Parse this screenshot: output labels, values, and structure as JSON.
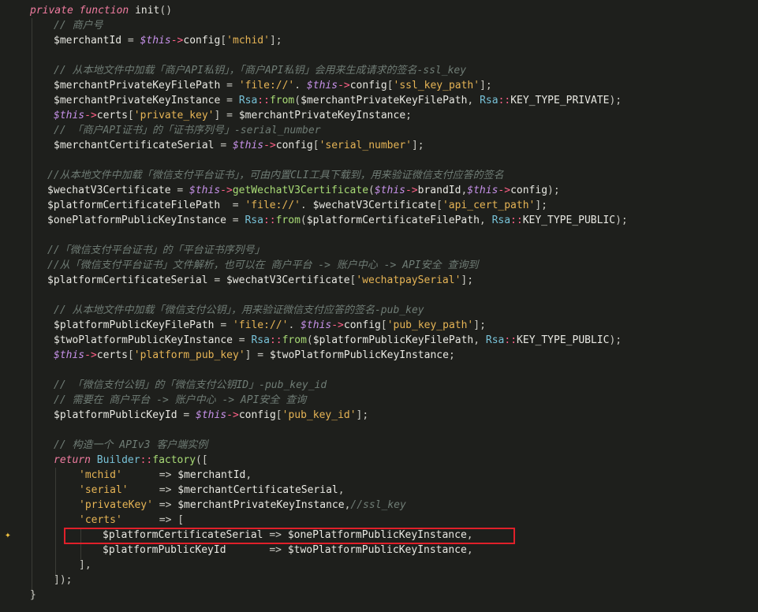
{
  "editor": {
    "lines": [
      {
        "indent": 38,
        "tokens": [
          [
            "kw",
            "private "
          ],
          [
            "kw",
            "function "
          ],
          [
            "fn",
            "init"
          ],
          [
            "pun",
            "()"
          ]
        ]
      },
      {
        "indent": 68,
        "tokens": [
          [
            "cmt",
            "// 商户号"
          ]
        ]
      },
      {
        "indent": 68,
        "tokens": [
          [
            "var",
            "$merchantId"
          ],
          [
            "pun",
            " = "
          ],
          [
            "this",
            "$this"
          ],
          [
            "op",
            "->"
          ],
          [
            "var",
            "config"
          ],
          [
            "pun",
            "["
          ],
          [
            "str",
            "'mchid'"
          ],
          [
            "pun",
            "];"
          ]
        ]
      },
      {
        "indent": 68,
        "tokens": []
      },
      {
        "indent": 68,
        "tokens": [
          [
            "cmt",
            "// 从本地文件中加载「商户API私钥」，「商户API私钥」会用来生成请求的签名-ssl_key"
          ]
        ]
      },
      {
        "indent": 68,
        "tokens": [
          [
            "var",
            "$merchantPrivateKeyFilePath"
          ],
          [
            "pun",
            " = "
          ],
          [
            "str",
            "'file://'"
          ],
          [
            "pun",
            ". "
          ],
          [
            "this",
            "$this"
          ],
          [
            "op",
            "->"
          ],
          [
            "var",
            "config"
          ],
          [
            "pun",
            "["
          ],
          [
            "str",
            "'ssl_key_path'"
          ],
          [
            "pun",
            "];"
          ]
        ]
      },
      {
        "indent": 68,
        "tokens": [
          [
            "var",
            "$merchantPrivateKeyInstance"
          ],
          [
            "pun",
            " = "
          ],
          [
            "cls",
            "Rsa"
          ],
          [
            "op",
            "::"
          ],
          [
            "meth",
            "from"
          ],
          [
            "pun",
            "("
          ],
          [
            "var",
            "$merchantPrivateKeyFilePath"
          ],
          [
            "pun",
            ", "
          ],
          [
            "cls",
            "Rsa"
          ],
          [
            "op",
            "::"
          ],
          [
            "var",
            "KEY_TYPE_PRIVATE"
          ],
          [
            "pun",
            ");"
          ]
        ]
      },
      {
        "indent": 68,
        "tokens": [
          [
            "this",
            "$this"
          ],
          [
            "op",
            "->"
          ],
          [
            "var",
            "certs"
          ],
          [
            "pun",
            "["
          ],
          [
            "str",
            "'private_key'"
          ],
          [
            "pun",
            "] = "
          ],
          [
            "var",
            "$merchantPrivateKeyInstance"
          ],
          [
            "pun",
            ";"
          ]
        ]
      },
      {
        "indent": 68,
        "tokens": [
          [
            "cmt",
            "// 「商户API证书」的「证书序列号」-serial_number"
          ]
        ]
      },
      {
        "indent": 68,
        "tokens": [
          [
            "var",
            "$merchantCertificateSerial"
          ],
          [
            "pun",
            " = "
          ],
          [
            "this",
            "$this"
          ],
          [
            "op",
            "->"
          ],
          [
            "var",
            "config"
          ],
          [
            "pun",
            "["
          ],
          [
            "str",
            "'serial_number'"
          ],
          [
            "pun",
            "];"
          ]
        ]
      },
      {
        "indent": 68,
        "tokens": []
      },
      {
        "indent": 60,
        "tokens": [
          [
            "cmt",
            "//从本地文件中加载「微信支付平台证书」，可由内置CLI工具下载到，用来验证微信支付应答的签名"
          ]
        ]
      },
      {
        "indent": 60,
        "tokens": [
          [
            "var",
            "$wechatV3Certificate"
          ],
          [
            "pun",
            " = "
          ],
          [
            "this",
            "$this"
          ],
          [
            "op",
            "->"
          ],
          [
            "meth",
            "getWechatV3Certificate"
          ],
          [
            "pun",
            "("
          ],
          [
            "this",
            "$this"
          ],
          [
            "op",
            "->"
          ],
          [
            "var",
            "brandId"
          ],
          [
            "pun",
            ","
          ],
          [
            "this",
            "$this"
          ],
          [
            "op",
            "->"
          ],
          [
            "var",
            "config"
          ],
          [
            "pun",
            ");"
          ]
        ]
      },
      {
        "indent": 60,
        "tokens": [
          [
            "var",
            "$platformCertificateFilePath"
          ],
          [
            "pun",
            "  = "
          ],
          [
            "str",
            "'file://'"
          ],
          [
            "pun",
            ". "
          ],
          [
            "var",
            "$wechatV3Certificate"
          ],
          [
            "pun",
            "["
          ],
          [
            "str",
            "'api_cert_path'"
          ],
          [
            "pun",
            "];"
          ]
        ]
      },
      {
        "indent": 60,
        "tokens": [
          [
            "var",
            "$onePlatformPublicKeyInstance"
          ],
          [
            "pun",
            " = "
          ],
          [
            "cls",
            "Rsa"
          ],
          [
            "op",
            "::"
          ],
          [
            "meth",
            "from"
          ],
          [
            "pun",
            "("
          ],
          [
            "var",
            "$platformCertificateFilePath"
          ],
          [
            "pun",
            ", "
          ],
          [
            "cls",
            "Rsa"
          ],
          [
            "op",
            "::"
          ],
          [
            "var",
            "KEY_TYPE_PUBLIC"
          ],
          [
            "pun",
            ");"
          ]
        ]
      },
      {
        "indent": 60,
        "tokens": []
      },
      {
        "indent": 60,
        "tokens": [
          [
            "cmt",
            "//「微信支付平台证书」的「平台证书序列号」"
          ]
        ]
      },
      {
        "indent": 60,
        "tokens": [
          [
            "cmt",
            "//从「微信支付平台证书」文件解析，也可以在 商户平台 -> 账户中心 -> API安全 查询到"
          ]
        ]
      },
      {
        "indent": 60,
        "tokens": [
          [
            "var",
            "$platformCertificateSerial"
          ],
          [
            "pun",
            " = "
          ],
          [
            "var",
            "$wechatV3Certificate"
          ],
          [
            "pun",
            "["
          ],
          [
            "str",
            "'wechatpaySerial'"
          ],
          [
            "pun",
            "];"
          ]
        ]
      },
      {
        "indent": 68,
        "tokens": []
      },
      {
        "indent": 68,
        "tokens": [
          [
            "cmt",
            "// 从本地文件中加载「微信支付公钥」，用来验证微信支付应答的签名-pub_key"
          ]
        ]
      },
      {
        "indent": 68,
        "tokens": [
          [
            "var",
            "$platformPublicKeyFilePath"
          ],
          [
            "pun",
            " = "
          ],
          [
            "str",
            "'file://'"
          ],
          [
            "pun",
            ". "
          ],
          [
            "this",
            "$this"
          ],
          [
            "op",
            "->"
          ],
          [
            "var",
            "config"
          ],
          [
            "pun",
            "["
          ],
          [
            "str",
            "'pub_key_path'"
          ],
          [
            "pun",
            "];"
          ]
        ]
      },
      {
        "indent": 68,
        "tokens": [
          [
            "var",
            "$twoPlatformPublicKeyInstance"
          ],
          [
            "pun",
            " = "
          ],
          [
            "cls",
            "Rsa"
          ],
          [
            "op",
            "::"
          ],
          [
            "meth",
            "from"
          ],
          [
            "pun",
            "("
          ],
          [
            "var",
            "$platformPublicKeyFilePath"
          ],
          [
            "pun",
            ", "
          ],
          [
            "cls",
            "Rsa"
          ],
          [
            "op",
            "::"
          ],
          [
            "var",
            "KEY_TYPE_PUBLIC"
          ],
          [
            "pun",
            ");"
          ]
        ]
      },
      {
        "indent": 68,
        "tokens": [
          [
            "this",
            "$this"
          ],
          [
            "op",
            "->"
          ],
          [
            "var",
            "certs"
          ],
          [
            "pun",
            "["
          ],
          [
            "str",
            "'platform_pub_key'"
          ],
          [
            "pun",
            "] = "
          ],
          [
            "var",
            "$twoPlatformPublicKeyInstance"
          ],
          [
            "pun",
            ";"
          ]
        ]
      },
      {
        "indent": 68,
        "tokens": []
      },
      {
        "indent": 68,
        "tokens": [
          [
            "cmt",
            "// 「微信支付公钥」的「微信支付公钥ID」-pub_key_id"
          ]
        ]
      },
      {
        "indent": 68,
        "tokens": [
          [
            "cmt",
            "// 需要在 商户平台 -> 账户中心 -> API安全 查询"
          ]
        ]
      },
      {
        "indent": 68,
        "tokens": [
          [
            "var",
            "$platformPublicKeyId"
          ],
          [
            "pun",
            " = "
          ],
          [
            "this",
            "$this"
          ],
          [
            "op",
            "->"
          ],
          [
            "var",
            "config"
          ],
          [
            "pun",
            "["
          ],
          [
            "str",
            "'pub_key_id'"
          ],
          [
            "pun",
            "];"
          ]
        ]
      },
      {
        "indent": 68,
        "tokens": []
      },
      {
        "indent": 68,
        "tokens": [
          [
            "cmt",
            "// 构造一个 APIv3 客户端实例"
          ]
        ]
      },
      {
        "indent": 68,
        "tokens": [
          [
            "kw",
            "return "
          ],
          [
            "cls",
            "Builder"
          ],
          [
            "op",
            "::"
          ],
          [
            "meth",
            "factory"
          ],
          [
            "pun",
            "(["
          ]
        ]
      },
      {
        "indent": 100,
        "tokens": [
          [
            "str",
            "'mchid'"
          ],
          [
            "pun",
            "      => "
          ],
          [
            "var",
            "$merchantId"
          ],
          [
            "pun",
            ","
          ]
        ]
      },
      {
        "indent": 100,
        "tokens": [
          [
            "str",
            "'serial'"
          ],
          [
            "pun",
            "     => "
          ],
          [
            "var",
            "$merchantCertificateSerial"
          ],
          [
            "pun",
            ","
          ]
        ]
      },
      {
        "indent": 100,
        "tokens": [
          [
            "str",
            "'privateKey'"
          ],
          [
            "pun",
            " => "
          ],
          [
            "var",
            "$merchantPrivateKeyInstance"
          ],
          [
            "pun",
            ","
          ],
          [
            "cmt",
            "//ssl_key"
          ]
        ]
      },
      {
        "indent": 100,
        "tokens": [
          [
            "str",
            "'certs'"
          ],
          [
            "pun",
            "      => ["
          ]
        ]
      },
      {
        "indent": 130,
        "tokens": [
          [
            "var",
            "$platformCertificateSerial"
          ],
          [
            "pun",
            " => "
          ],
          [
            "var",
            "$onePlatformPublicKeyInstance"
          ],
          [
            "pun",
            ","
          ]
        ]
      },
      {
        "indent": 130,
        "tokens": [
          [
            "var",
            "$platformPublicKeyId"
          ],
          [
            "pun",
            "       => "
          ],
          [
            "var",
            "$twoPlatformPublicKeyInstance"
          ],
          [
            "pun",
            ","
          ]
        ]
      },
      {
        "indent": 100,
        "tokens": [
          [
            "pun",
            "],"
          ]
        ]
      },
      {
        "indent": 68,
        "tokens": [
          [
            "pun",
            "]);"
          ]
        ]
      },
      {
        "indent": 38,
        "tokens": [
          [
            "pun",
            "}"
          ]
        ]
      }
    ],
    "bulb_icon": "lightbulb-sparkle-icon",
    "highlight_color": "#e0202a"
  }
}
